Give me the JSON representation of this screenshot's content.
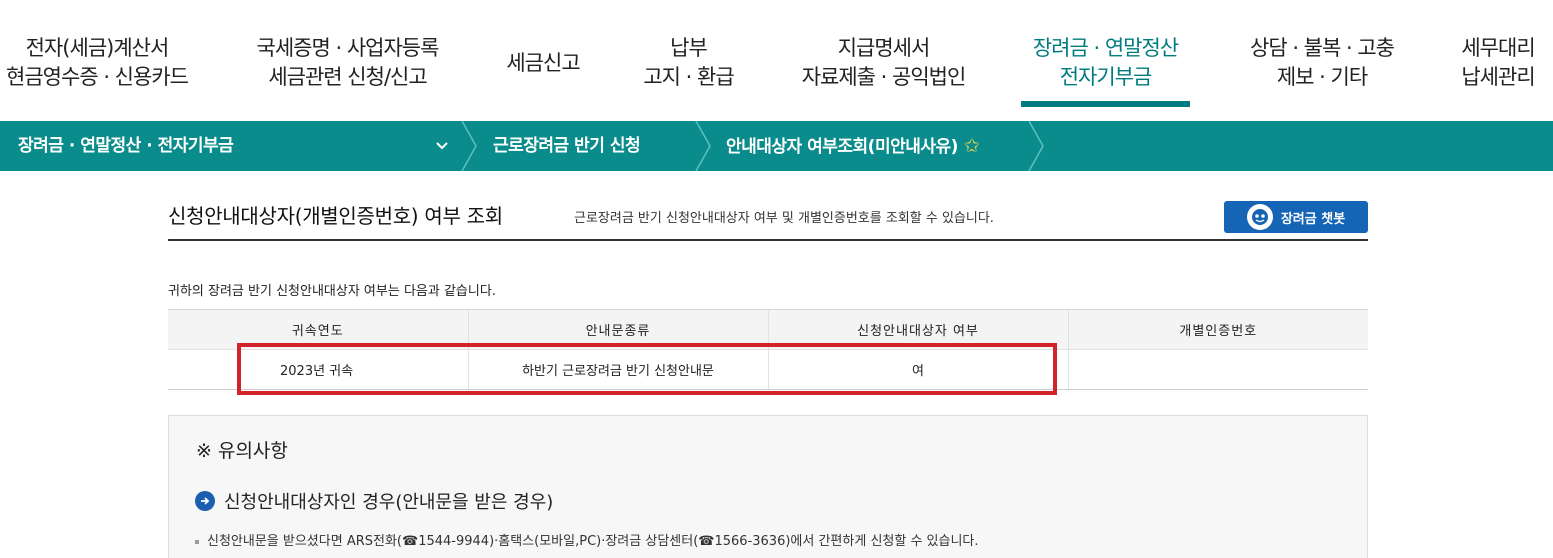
{
  "gnb": {
    "items": [
      {
        "line1": "전자(세금)계산서",
        "line2": "현금영수증 · 신용카드"
      },
      {
        "line1": "국세증명 · 사업자등록",
        "line2": "세금관련 신청/신고"
      },
      {
        "line1": "세금신고",
        "line2": ""
      },
      {
        "line1": "납부",
        "line2": "고지 · 환급"
      },
      {
        "line1": "지급명세서",
        "line2": "자료제출 · 공익법인"
      },
      {
        "line1": "장려금 · 연말정산",
        "line2": "전자기부금"
      },
      {
        "line1": "상담 · 불복 · 고충",
        "line2": "제보 · 기타"
      },
      {
        "line1": "세무대리",
        "line2": "납세관리"
      }
    ],
    "accent_color": "#007c80"
  },
  "breadcrumb": {
    "level1": "장려금 · 연말정산 · 전자기부금",
    "level2": "근로장려금 반기 신청",
    "level3": "안내대상자 여부조회(미안내사유)",
    "bar_color": "#0b8c8c"
  },
  "page": {
    "title": "신청안내대상자(개별인증번호) 여부 조회",
    "description": "근로장려금 반기 신청안내대상자 여부 및 개별인증번호를 조회할 수 있습니다.",
    "chatbot_label": "장려금 챗봇",
    "notice": "귀하의 장려금 반기 신청안내대상자 여부는 다음과 같습니다."
  },
  "table": {
    "headers": [
      "귀속연도",
      "안내문종류",
      "신청안내대상자 여부",
      "개별인증번호"
    ],
    "rows": [
      [
        "2023년 귀속",
        "하반기 근로장려금 반기 신청안내문",
        "여",
        ""
      ]
    ]
  },
  "caution": {
    "title": "※ 유의사항",
    "subtitle": "신청안내대상자인 경우(안내문을 받은 경우)",
    "bullet_before_1": "신청안내문을 받으셨다면 ARS전화(",
    "phone1": "1544-9944",
    "bullet_middle": ")·홈택스(모바일,PC)·장려금 상담센터(",
    "phone2": "1566-3636",
    "bullet_after": ")에서 간편하게 신청할 수 있습니다."
  }
}
